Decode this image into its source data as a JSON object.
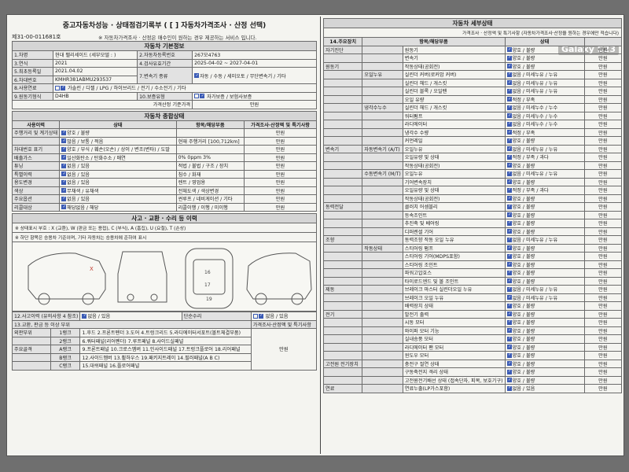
{
  "doc": {
    "title": "중고자동차성능 · 상태점검기록부 ( [   ] 자동차가격조사 · 산정 선택)",
    "doc_no": "제31-00-011681호",
    "notice": "※ 자동차가격조사 · 산정은 매수인이 원하는 경우 제공하는 서비스 입니다.",
    "watermark": "Galaxy S23"
  },
  "basic": {
    "heading": "자동차 기본정보",
    "rows": [
      {
        "label": "1.차명",
        "value": "현대 팰리세이드 (세부모델 : )",
        "label2": "2.자동차등록번호",
        "value2": "267모4763"
      },
      {
        "label": "3.연식",
        "value": "2021",
        "label2": "4.검사유효기간",
        "value2": "2025-04-02 ~ 2027-04-01"
      },
      {
        "label": "5.최초등록일",
        "value": "2021.04.02",
        "label2": "7.변속기 종류",
        "value2": "자동 / 수동 / 세미오토 / 무단변속기 / 기타"
      },
      {
        "label": "6.차대번호",
        "value": "KMHR381ABMU293537",
        "label2": "",
        "value2": ""
      },
      {
        "label": "8.사용연료",
        "value": "가솔린 / 디젤 / LPG / 하이브리드 / 전기 / 수소전기 / 기타",
        "label2": "",
        "value2": ""
      },
      {
        "label": "9.원동기형식",
        "value": "D4HB",
        "label2": "10.보증유형",
        "value2": "자가보증 / 보험사보증"
      }
    ],
    "price_label": "가격산정 기준가격",
    "unit": "만원"
  },
  "overall": {
    "heading": "자동차 종합상태",
    "cols": [
      "사용이력",
      "상태",
      "항목/해당부품",
      "가격조사·산정액 및 특기사항"
    ],
    "rows": [
      {
        "name": "주행거리 및 계기상태",
        "state": "양호 / 불량",
        "item": "",
        "note": "만원"
      },
      {
        "name": "",
        "state": "많음 / 보통 / 적음",
        "item": "현재 주행거리 [100,712km]",
        "note": "만원"
      },
      {
        "name": "차대번호 표기",
        "state": "양호 / 부식 / 훼손(오손) / 상이 / 변조(변타) / 도말",
        "item": "",
        "note": "만원"
      },
      {
        "name": "배출가스",
        "state": "일산화탄소 / 탄화수소 / 매연",
        "item": "0%   0ppm   3%",
        "note": "만원"
      },
      {
        "name": "튜닝",
        "state": "없음 / 있음",
        "item": "적법 / 불법 / 구조 / 장치",
        "note": "만원"
      },
      {
        "name": "특별이력",
        "state": "없음 / 있음",
        "item": "침수 / 화재",
        "note": "만원"
      },
      {
        "name": "용도변경",
        "state": "없음 / 있음",
        "item": "렌트 / 영업용",
        "note": "만원"
      },
      {
        "name": "색상",
        "state": "무채색 / 유채색",
        "item": "전체도색 / 색상변경",
        "note": "만원"
      },
      {
        "name": "주요옵션",
        "state": "없음 / 있음",
        "item": "썬루프 / 네비게이션 / 기타",
        "note": "만원"
      },
      {
        "name": "리콜대상",
        "state": "해당없음 / 해당",
        "item": "리콜이행 / 이행 / 미이행",
        "note": "만원"
      }
    ]
  },
  "accident": {
    "heading": "사고 · 교환 · 수리 등 이력",
    "legend": "※ 상태표시 부호 : X (교환), W (판금 또는 용접), C (부식), A (흠집), U (요철), T (손상)",
    "legend2": "※ 하단 항목은 승용차 기준이며, 기타 자동차는 승용차에 준하여 표시",
    "accident_row": {
      "label": "12.사고이력 (유의사항 4 참조)",
      "v1": "없음 / 있음",
      "label2": "단순수리",
      "v2": "없음 / 있음"
    },
    "issue_label": "13.교환, 판금 등 이상 부위",
    "note_label": "가격조사·산정액 및 특기사항",
    "panels": [
      {
        "group": "외판부위",
        "rank": "1랭크",
        "items": "1.후드  2.프론트펜더  3.도어  4.트렁크리드  5.라디에이터서포트(볼트체결부품)"
      },
      {
        "group": "",
        "rank": "2랭크",
        "items": "6.쿼터패널(리어펜더)  7.루프패널  8.사이드실패널"
      },
      {
        "group": "주요골격",
        "rank": "A랭크",
        "items": "9.프론트패널  10.크로스멤버  11.인사이드패널  17.트렁크플로어  18.리어패널"
      },
      {
        "group": "",
        "rank": "B랭크",
        "items": "12.사이드멤버  13.휠하우스  19.패키지트레이  14.필러패널(A  B  C)"
      },
      {
        "group": "",
        "rank": "C랭크",
        "items": "15.대쉬패널  16.플로어패널"
      }
    ],
    "price": "만원"
  },
  "detail": {
    "heading": "자동차 세부상태",
    "notice": "가격조사 · 산정액 및 특기사항 (자동차가격조사·산정을 원하는 경우에만 적습니다)",
    "cols": [
      "14.주요장치",
      "항목/해당부품",
      "상태"
    ],
    "rows": [
      {
        "group": "자기진단",
        "sub": "",
        "item": "원동기",
        "state": "양호 / 불량"
      },
      {
        "group": "",
        "sub": "",
        "item": "변속기",
        "state": "양호 / 불량"
      },
      {
        "group": "원동기",
        "sub": "",
        "item": "작동상태(공회전)",
        "state": "양호 / 불량"
      },
      {
        "group": "",
        "sub": "오일누유",
        "item": "실린더 커버(로커암 커버)",
        "state": "없음 / 미세누유 / 누유"
      },
      {
        "group": "",
        "sub": "",
        "item": "실린더 헤드 / 개스킷",
        "state": "없음 / 미세누유 / 누유"
      },
      {
        "group": "",
        "sub": "",
        "item": "실린더 블록 / 오일팬",
        "state": "없음 / 미세누유 / 누유"
      },
      {
        "group": "",
        "sub": "",
        "item": "오일 유량",
        "state": "적정 / 부족"
      },
      {
        "group": "",
        "sub": "냉각수누수",
        "item": "실린더 헤드 / 개스킷",
        "state": "없음 / 미세누수 / 누수"
      },
      {
        "group": "",
        "sub": "",
        "item": "워터펌프",
        "state": "없음 / 미세누수 / 누수"
      },
      {
        "group": "",
        "sub": "",
        "item": "라디에이터",
        "state": "없음 / 미세누수 / 누수"
      },
      {
        "group": "",
        "sub": "",
        "item": "냉각수 수량",
        "state": "적정 / 부족"
      },
      {
        "group": "",
        "sub": "",
        "item": "커먼레일",
        "state": "양호 / 불량"
      },
      {
        "group": "변속기",
        "sub": "자동변속기 (A/T)",
        "item": "오일누유",
        "state": "없음 / 미세누유 / 누유"
      },
      {
        "group": "",
        "sub": "",
        "item": "오일유량 및 상태",
        "state": "적정 / 부족 / 과다"
      },
      {
        "group": "",
        "sub": "",
        "item": "작동상태(공회전)",
        "state": "양호 / 불량"
      },
      {
        "group": "",
        "sub": "수동변속기 (M/T)",
        "item": "오일누유",
        "state": "없음 / 미세누유 / 누유"
      },
      {
        "group": "",
        "sub": "",
        "item": "기어변속장치",
        "state": "양호 / 불량"
      },
      {
        "group": "",
        "sub": "",
        "item": "오일유량 및 상태",
        "state": "적정 / 부족 / 과다"
      },
      {
        "group": "",
        "sub": "",
        "item": "작동상태(공회전)",
        "state": "양호 / 불량"
      },
      {
        "group": "동력전달",
        "sub": "",
        "item": "클러치 어셈블리",
        "state": "양호 / 불량"
      },
      {
        "group": "",
        "sub": "",
        "item": "등속조인트",
        "state": "양호 / 불량"
      },
      {
        "group": "",
        "sub": "",
        "item": "추진축 및 베어링",
        "state": "양호 / 불량"
      },
      {
        "group": "",
        "sub": "",
        "item": "디퍼렌셜 기어",
        "state": "양호 / 불량"
      },
      {
        "group": "조향",
        "sub": "",
        "item": "동력조향 작동 오일 누유",
        "state": "없음 / 미세누유 / 누유"
      },
      {
        "group": "",
        "sub": "작동상태",
        "item": "스티어링 펌프",
        "state": "양호 / 불량"
      },
      {
        "group": "",
        "sub": "",
        "item": "스티어링 기어(MDPS포함)",
        "state": "양호 / 불량"
      },
      {
        "group": "",
        "sub": "",
        "item": "스티어링 조인트",
        "state": "양호 / 불량"
      },
      {
        "group": "",
        "sub": "",
        "item": "파워고압호스",
        "state": "양호 / 불량"
      },
      {
        "group": "",
        "sub": "",
        "item": "타이로드엔드 및 볼 조인트",
        "state": "양호 / 불량"
      },
      {
        "group": "제동",
        "sub": "",
        "item": "브레이크 마스터 실린더오일 누유",
        "state": "없음 / 미세누유 / 누유"
      },
      {
        "group": "",
        "sub": "",
        "item": "브레이크 오일 누유",
        "state": "없음 / 미세누유 / 누유"
      },
      {
        "group": "",
        "sub": "",
        "item": "배력장치 상태",
        "state": "양호 / 불량"
      },
      {
        "group": "전기",
        "sub": "",
        "item": "발전기 출력",
        "state": "양호 / 불량"
      },
      {
        "group": "",
        "sub": "",
        "item": "시동 모터",
        "state": "양호 / 불량"
      },
      {
        "group": "",
        "sub": "",
        "item": "와이퍼 모터 기능",
        "state": "양호 / 불량"
      },
      {
        "group": "",
        "sub": "",
        "item": "실내송풍 모터",
        "state": "양호 / 불량"
      },
      {
        "group": "",
        "sub": "",
        "item": "라디에이터 팬 모터",
        "state": "양호 / 불량"
      },
      {
        "group": "",
        "sub": "",
        "item": "윈도우 모터",
        "state": "양호 / 불량"
      },
      {
        "group": "고전원 전기장치",
        "sub": "",
        "item": "충전구 절연 상태",
        "state": "양호 / 불량"
      },
      {
        "group": "",
        "sub": "",
        "item": "구동축전지 격리 상태",
        "state": "양호 / 불량"
      },
      {
        "group": "",
        "sub": "",
        "item": "고전원전기배선 상태 (접속단자, 피복, 보호기구)",
        "state": "양호 / 불량"
      },
      {
        "group": "연료",
        "sub": "",
        "item": "연료누출(LP가스포함)",
        "state": "없음 / 있음"
      }
    ],
    "price": "만원"
  }
}
